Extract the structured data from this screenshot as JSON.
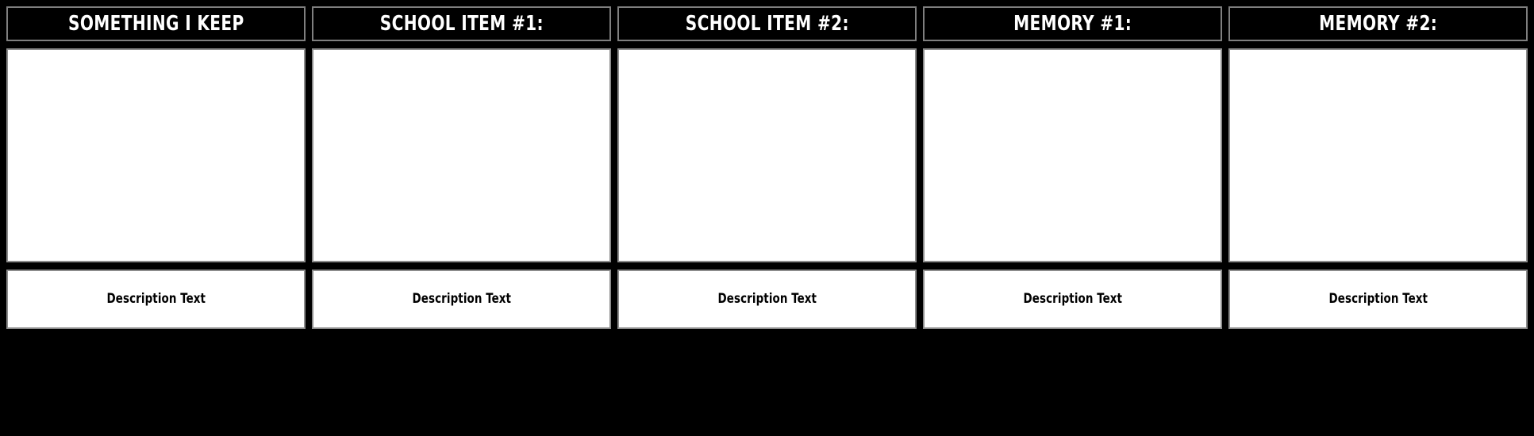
{
  "board": {
    "background_color": "#000000",
    "cell_background_color": "#ffffff",
    "cell_border_color": "#8c8c8c",
    "header_background_color": "#000000",
    "header_border_color": "#7f7f7f",
    "header_text_color": "#ffffff",
    "description_text_color": "#000000",
    "column_count": 5
  },
  "columns": [
    {
      "header": "SOMETHING I KEEP",
      "image": "",
      "description": "Description Text"
    },
    {
      "header": "SCHOOL ITEM #1:",
      "image": "",
      "description": "Description Text"
    },
    {
      "header": "SCHOOL ITEM #2:",
      "image": "",
      "description": "Description Text"
    },
    {
      "header": "MEMORY #1:",
      "image": "",
      "description": "Description Text"
    },
    {
      "header": "MEMORY #2:",
      "image": "",
      "description": "Description Text"
    }
  ]
}
